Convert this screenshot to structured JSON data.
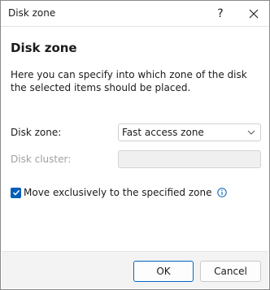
{
  "window": {
    "title": "Disk zone",
    "help_label": "?",
    "close_icon": "close-icon"
  },
  "content": {
    "heading": "Disk zone",
    "description": "Here you can specify into which zone of the disk the selected items should be placed."
  },
  "form": {
    "disk_zone_label": "Disk zone:",
    "disk_zone_value": "Fast access zone",
    "disk_cluster_label": "Disk cluster:",
    "disk_cluster_value": "",
    "checkbox_label": "Move exclusively to the specified zone",
    "checkbox_checked": true
  },
  "buttons": {
    "ok_label": "OK",
    "cancel_label": "Cancel"
  },
  "colors": {
    "accent": "#005fb8",
    "footer_bg": "#f3f3f3",
    "disabled_text": "#a0a0a0"
  }
}
